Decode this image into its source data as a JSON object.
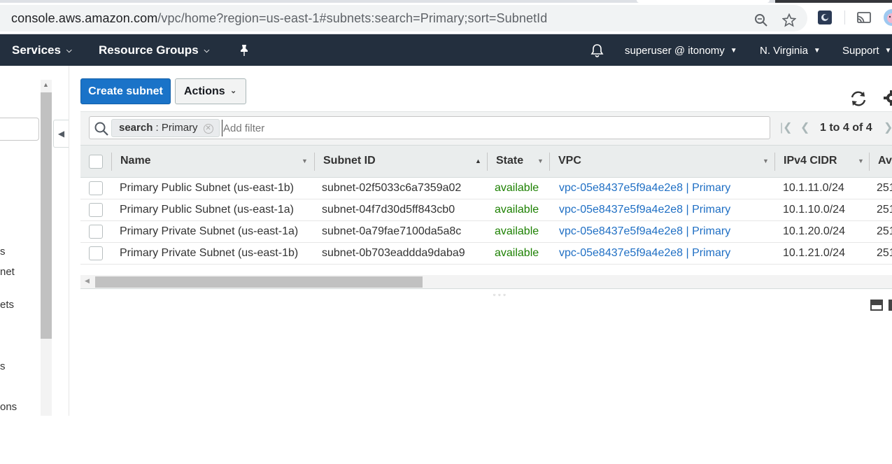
{
  "browser": {
    "url_host": "console.aws.amazon.com",
    "url_path": "/vpc/home?region=us-east-1#subnets:search=Primary;sort=SubnetId"
  },
  "nav": {
    "services": "Services",
    "resource_groups": "Resource Groups",
    "user": "superuser @ itonomy",
    "region": "N. Virginia",
    "support": "Support"
  },
  "sidebar": {
    "items": [
      "s",
      "net",
      "ets",
      "s",
      "ons"
    ]
  },
  "toolbar": {
    "create_label": "Create subnet",
    "actions_label": "Actions"
  },
  "filter": {
    "token_key": "search",
    "token_value": ": Primary",
    "placeholder": "Add filter",
    "pagination": "1 to 4 of 4"
  },
  "table": {
    "columns": [
      "Name",
      "Subnet ID",
      "State",
      "VPC",
      "IPv4 CIDR",
      "Av"
    ],
    "rows": [
      {
        "name": "Primary Public Subnet (us-east-1b)",
        "subnet_id": "subnet-02f5033c6a7359a02",
        "state": "available",
        "vpc": "vpc-05e8437e5f9a4e2e8 | Primary",
        "cidr": "10.1.11.0/24",
        "avail": "251"
      },
      {
        "name": "Primary Public Subnet (us-east-1a)",
        "subnet_id": "subnet-04f7d30d5ff843cb0",
        "state": "available",
        "vpc": "vpc-05e8437e5f9a4e2e8 | Primary",
        "cidr": "10.1.10.0/24",
        "avail": "251"
      },
      {
        "name": "Primary Private Subnet (us-east-1a)",
        "subnet_id": "subnet-0a79fae7100da5a8c",
        "state": "available",
        "vpc": "vpc-05e8437e5f9a4e2e8 | Primary",
        "cidr": "10.1.20.0/24",
        "avail": "251"
      },
      {
        "name": "Primary Private Subnet (us-east-1b)",
        "subnet_id": "subnet-0b703eaddda9daba9",
        "state": "available",
        "vpc": "vpc-05e8437e5f9a4e2e8 | Primary",
        "cidr": "10.1.21.0/24",
        "avail": "251"
      }
    ]
  },
  "colors": {
    "nav_bg": "#232f3e",
    "primary_button": "#1a73c8",
    "state_available": "#1d8102",
    "link": "#1f6fc4"
  }
}
